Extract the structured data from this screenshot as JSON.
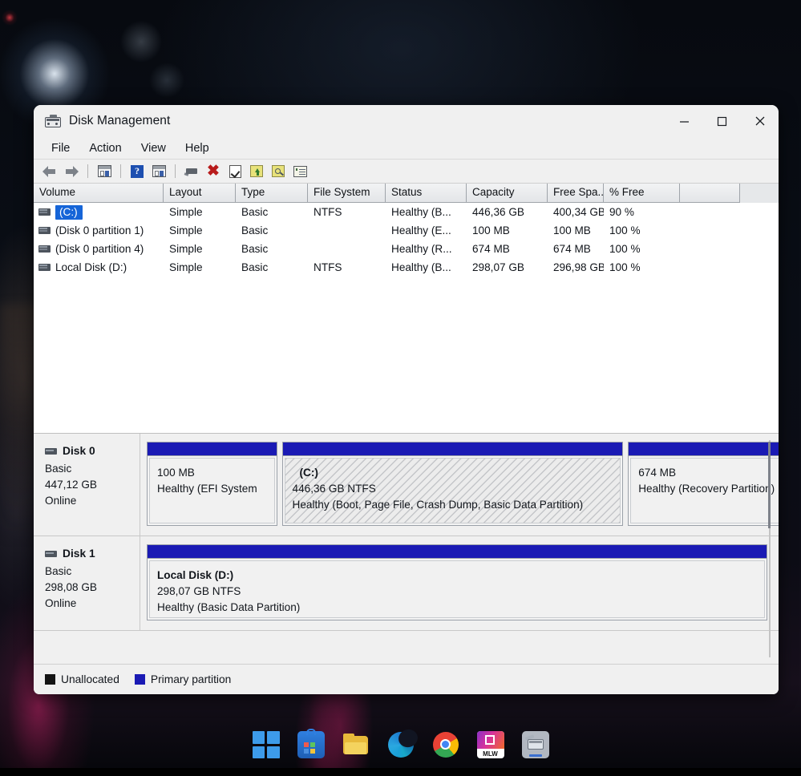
{
  "window": {
    "title": "Disk Management",
    "app_icon": "disk-management-icon",
    "controls": {
      "minimize": "minimize-icon",
      "maximize": "maximize-icon",
      "close": "close-icon"
    }
  },
  "menubar": {
    "items": [
      {
        "label": "File"
      },
      {
        "label": "Action"
      },
      {
        "label": "View"
      },
      {
        "label": "Help"
      }
    ]
  },
  "toolbar": {
    "buttons": [
      {
        "name": "back-icon"
      },
      {
        "name": "forward-icon"
      },
      {
        "name": "show-hide-console-tree-icon"
      },
      {
        "name": "help-icon"
      },
      {
        "name": "show-hide-action-pane-icon"
      },
      {
        "name": "disk-icon"
      },
      {
        "name": "delete-icon"
      },
      {
        "name": "properties-icon"
      },
      {
        "name": "extend-volume-icon"
      },
      {
        "name": "examine-icon"
      },
      {
        "name": "list-view-icon"
      }
    ]
  },
  "volume_table": {
    "columns": [
      "Volume",
      "Layout",
      "Type",
      "File System",
      "Status",
      "Capacity",
      "Free Spa...",
      "% Free",
      ""
    ],
    "rows": [
      {
        "volume": "(C:)",
        "selected": true,
        "layout": "Simple",
        "type": "Basic",
        "file_system": "NTFS",
        "status": "Healthy (B...",
        "capacity": "446,36 GB",
        "free_space": "400,34 GB",
        "percent_free": "90 %"
      },
      {
        "volume": "(Disk 0 partition 1)",
        "selected": false,
        "layout": "Simple",
        "type": "Basic",
        "file_system": "",
        "status": "Healthy (E...",
        "capacity": "100 MB",
        "free_space": "100 MB",
        "percent_free": "100 %"
      },
      {
        "volume": "(Disk 0 partition 4)",
        "selected": false,
        "layout": "Simple",
        "type": "Basic",
        "file_system": "",
        "status": "Healthy (R...",
        "capacity": "674 MB",
        "free_space": "674 MB",
        "percent_free": "100 %"
      },
      {
        "volume": "Local Disk (D:)",
        "selected": false,
        "layout": "Simple",
        "type": "Basic",
        "file_system": "NTFS",
        "status": "Healthy (B...",
        "capacity": "298,07 GB",
        "free_space": "296,98 GB",
        "percent_free": "100 %"
      }
    ]
  },
  "disks": [
    {
      "name": "Disk 0",
      "type": "Basic",
      "size": "447,12 GB",
      "state": "Online",
      "partitions": [
        {
          "name": "",
          "size": "100 MB",
          "status": "Healthy (EFI System",
          "selected": false,
          "width_pct": 21
        },
        {
          "name": "(C:)",
          "size": "446,36 GB NTFS",
          "status": "Healthy (Boot, Page File, Crash Dump, Basic Data Partition)",
          "selected": true,
          "width_pct": 55
        },
        {
          "name": "",
          "size": "674 MB",
          "status": "Healthy (Recovery Partition)",
          "selected": false,
          "width_pct": 26
        }
      ]
    },
    {
      "name": "Disk 1",
      "type": "Basic",
      "size": "298,08 GB",
      "state": "Online",
      "partitions": [
        {
          "name": "Local Disk  (D:)",
          "size": "298,07 GB NTFS",
          "status": "Healthy (Basic Data Partition)",
          "selected": false,
          "width_pct": 100
        }
      ]
    }
  ],
  "legend": {
    "items": [
      {
        "label": "Unallocated",
        "color": "#141414"
      },
      {
        "label": "Primary partition",
        "color": "#1a1ab4"
      }
    ]
  },
  "taskbar": {
    "items": [
      {
        "name": "start-icon",
        "label": "Start"
      },
      {
        "name": "microsoft-store-icon",
        "label": "Microsoft Store"
      },
      {
        "name": "file-explorer-icon",
        "label": "File Explorer"
      },
      {
        "name": "microsoft-edge-icon",
        "label": "Microsoft Edge"
      },
      {
        "name": "google-chrome-icon",
        "label": "Google Chrome"
      },
      {
        "name": "mlw-app-icon",
        "label": "MLW"
      },
      {
        "name": "disk-management-taskbar-icon",
        "label": "Disk Management"
      }
    ]
  },
  "colors": {
    "partition_bar": "#1a1ab4",
    "selection": "#1665d8",
    "window_bg": "#f0f0f0"
  }
}
